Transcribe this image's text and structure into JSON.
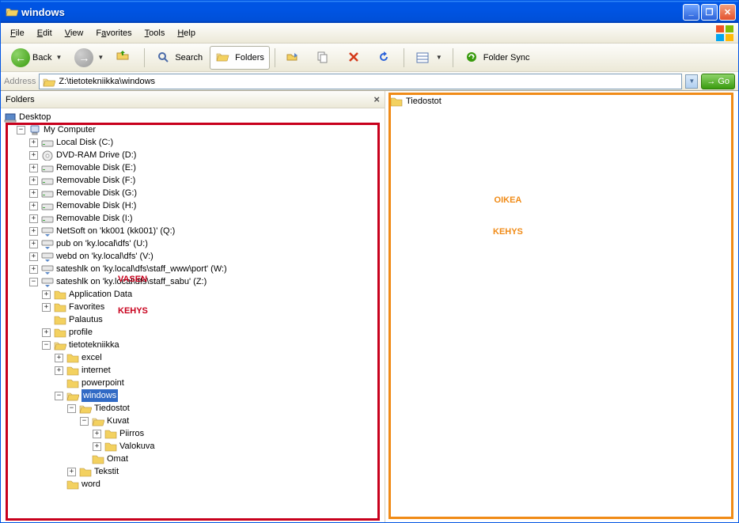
{
  "window": {
    "title": "windows"
  },
  "menu": {
    "file": "File",
    "edit": "Edit",
    "view": "View",
    "favorites": "Favorites",
    "tools": "Tools",
    "help": "Help"
  },
  "toolbar": {
    "back": "Back",
    "search": "Search",
    "folders": "Folders",
    "foldersync": "Folder Sync"
  },
  "address": {
    "label": "Address",
    "value": "Z:\\tietotekniikka\\windows",
    "go": "Go"
  },
  "folders_pane": {
    "title": "Folders"
  },
  "tree": {
    "desktop": "Desktop",
    "mycomputer": "My Computer",
    "c": "Local Disk (C:)",
    "d": "DVD-RAM Drive (D:)",
    "e": "Removable Disk (E:)",
    "f": "Removable Disk (F:)",
    "g": "Removable Disk (G:)",
    "h": "Removable Disk (H:)",
    "i": "Removable Disk (I:)",
    "q": "NetSoft on 'kk001 (kk001)' (Q:)",
    "u": "pub on 'ky.local\\dfs' (U:)",
    "v": "webd on 'ky.local\\dfs' (V:)",
    "w": "sateshlk on 'ky.local\\dfs\\staff_www\\port' (W:)",
    "z": "sateshlk on 'ky.local\\dfs\\staff_sabu' (Z:)",
    "appdata": "Application Data",
    "favorites": "Favorites",
    "palautus": "Palautus",
    "profile": "profile",
    "tietotekniikka": "tietotekniikka",
    "excel": "excel",
    "internet": "internet",
    "powerpoint": "powerpoint",
    "windows": "windows",
    "tiedostot": "Tiedostot",
    "kuvat": "Kuvat",
    "piirros": "Piirros",
    "valokuva": "Valokuva",
    "omat": "Omat",
    "tekstit": "Tekstit",
    "word": "word"
  },
  "content": {
    "tiedostot": "Tiedostot"
  },
  "annotation": {
    "left1": "VASEN",
    "left2": "KEHYS",
    "right1": "OIKEA",
    "right2": "KEHYS"
  }
}
